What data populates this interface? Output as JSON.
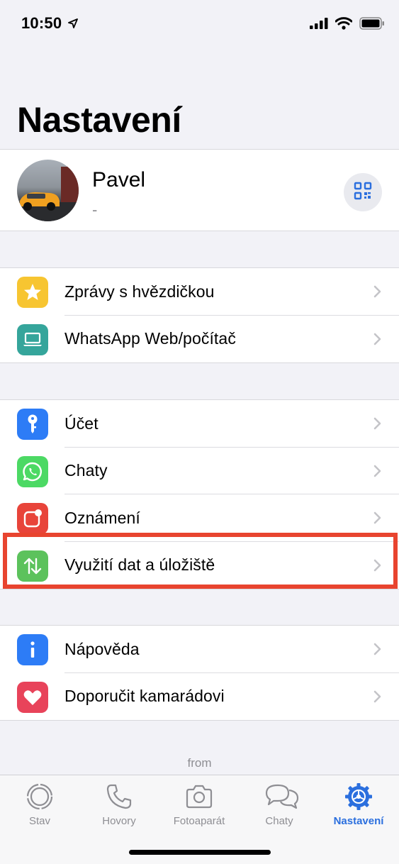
{
  "status_bar": {
    "time": "10:50"
  },
  "title": "Nastavení",
  "profile": {
    "name": "Pavel",
    "status": "-"
  },
  "groups": [
    [
      {
        "label": "Zprávy s hvězdičkou",
        "icon": "star-icon",
        "color": "#f7c531"
      },
      {
        "label": "WhatsApp Web/počítač",
        "icon": "laptop-icon",
        "color": "#35a59b"
      }
    ],
    [
      {
        "label": "Účet",
        "icon": "key-icon",
        "color": "#2d7cf6"
      },
      {
        "label": "Chaty",
        "icon": "whatsapp-icon",
        "color": "#4cd964"
      },
      {
        "label": "Oznámení",
        "icon": "notification-icon",
        "color": "#e8443a"
      },
      {
        "label": "Využití dat a úložiště",
        "icon": "data-arrows-icon",
        "color": "#5cc25c"
      }
    ],
    [
      {
        "label": "Nápověda",
        "icon": "info-icon",
        "color": "#2d7cf6"
      },
      {
        "label": "Doporučit kamarádovi",
        "icon": "heart-icon",
        "color": "#e8435a"
      }
    ]
  ],
  "footer": {
    "from": "from"
  },
  "tabs": [
    {
      "label": "Stav",
      "icon": "status-icon"
    },
    {
      "label": "Hovory",
      "icon": "phone-icon"
    },
    {
      "label": "Fotoaparát",
      "icon": "camera-icon"
    },
    {
      "label": "Chaty",
      "icon": "chats-icon"
    },
    {
      "label": "Nastavení",
      "icon": "settings-icon",
      "active": true
    }
  ],
  "colors": {
    "accent": "#2b6fde",
    "highlight": "#e8442f",
    "background": "#f2f2f7"
  }
}
